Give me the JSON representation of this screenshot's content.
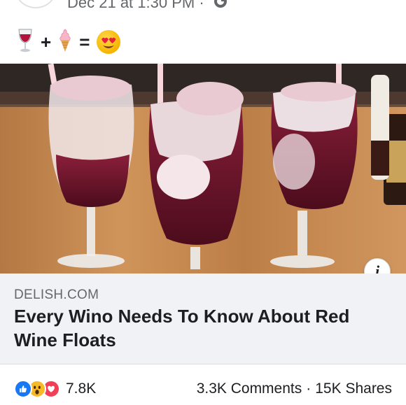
{
  "header": {
    "timestamp": "Dec 21 at 1:30 PM ·"
  },
  "post": {
    "message_emojis": [
      "wine-glass",
      "plus",
      "soft-ice-cream",
      "equals",
      "smiling-face-with-heart-eyes"
    ],
    "plus": "+",
    "equals": "="
  },
  "link": {
    "domain": "DELISH.COM",
    "title": "Every Wino Needs To Know About Red Wine Floats"
  },
  "engagement": {
    "reaction_icons": [
      "like-icon",
      "wow-icon",
      "love-icon"
    ],
    "reaction_count": "7.8K",
    "comments": "3.3K Comments",
    "separator": "·",
    "shares": "15K Shares"
  },
  "colors": {
    "facebook_blue": "#1877f2",
    "wow_yellow": "#f7b928",
    "love_red": "#f33e58",
    "card_background": "#f0f2f5",
    "secondary_text": "#65676b"
  }
}
